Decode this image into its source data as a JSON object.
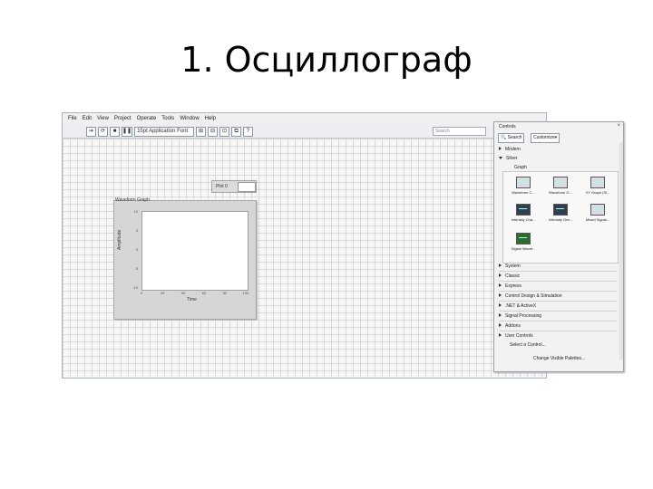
{
  "slide": {
    "title": "1. Осциллограф"
  },
  "window": {
    "menu": [
      "File",
      "Edit",
      "View",
      "Project",
      "Operate",
      "Tools",
      "Window",
      "Help"
    ],
    "toolbar": {
      "font_select": "15pt Application Font",
      "search_placeholder": "Search"
    }
  },
  "graph": {
    "title": "Waveform Graph",
    "legend_label": "Plot 0",
    "xlabel": "Time",
    "ylabel": "Amplitude",
    "yticks": [
      "10",
      "5",
      "0",
      "-5",
      "-10"
    ],
    "xticks": [
      "0",
      "20",
      "40",
      "60",
      "80",
      "100"
    ]
  },
  "palette": {
    "title": "Controls",
    "close": "×",
    "search": "Search",
    "customize": "Customize▾",
    "modern": "Modern",
    "silver": "Silver",
    "graph_category": "Graph",
    "graph_items": [
      "Waveform C...",
      "Waveform G...",
      "XY Graph (Si...",
      "Intensity Cha...",
      "Intensity Gra...",
      "Mixed Signal...",
      "Digital Wavef..."
    ],
    "categories": [
      "System",
      "Classic",
      "Express",
      "Control Design & Simulation",
      ".NET & ActiveX",
      "Signal Processing",
      "Addons",
      "User Controls"
    ],
    "select_control": "Select a Control...",
    "change_palettes": "Change Visible Palettes..."
  }
}
